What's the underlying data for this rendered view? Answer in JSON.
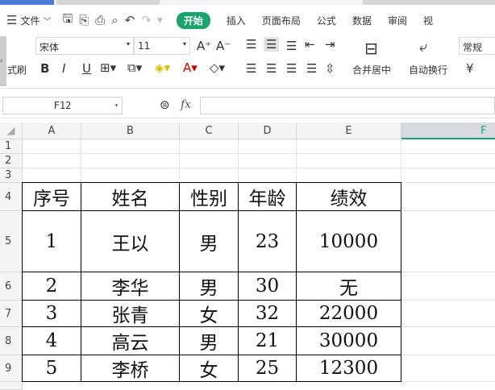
{
  "menu": {
    "file": "文件",
    "tabs": [
      "开始",
      "插入",
      "页面布局",
      "公式",
      "数据",
      "审阅",
      "视"
    ]
  },
  "ribbon": {
    "format_painter": "式刷",
    "font": "宋体",
    "size": "11",
    "merge": "合并居中",
    "wrap": "自动换行",
    "number_format": "常规",
    "currency": "¥"
  },
  "formula_bar": {
    "name_box": "F12",
    "fx": "fx",
    "value": ""
  },
  "columns": [
    "A",
    "B",
    "C",
    "D",
    "E",
    "F"
  ],
  "rows": [
    "1",
    "2",
    "3",
    "4",
    "5",
    "6",
    "7",
    "8",
    "9"
  ],
  "table": {
    "header": [
      "序号",
      "姓名",
      "性别",
      "年龄",
      "绩效"
    ],
    "rows": [
      [
        "1",
        "王以",
        "男",
        "23",
        "10000"
      ],
      [
        "2",
        "李华",
        "男",
        "30",
        "无"
      ],
      [
        "3",
        "张青",
        "女",
        "32",
        "22000"
      ],
      [
        "4",
        "高云",
        "男",
        "21",
        "30000"
      ],
      [
        "5",
        "李桥",
        "女",
        "25",
        "12300"
      ]
    ]
  },
  "colors": {
    "accent": "#1aa36b"
  }
}
